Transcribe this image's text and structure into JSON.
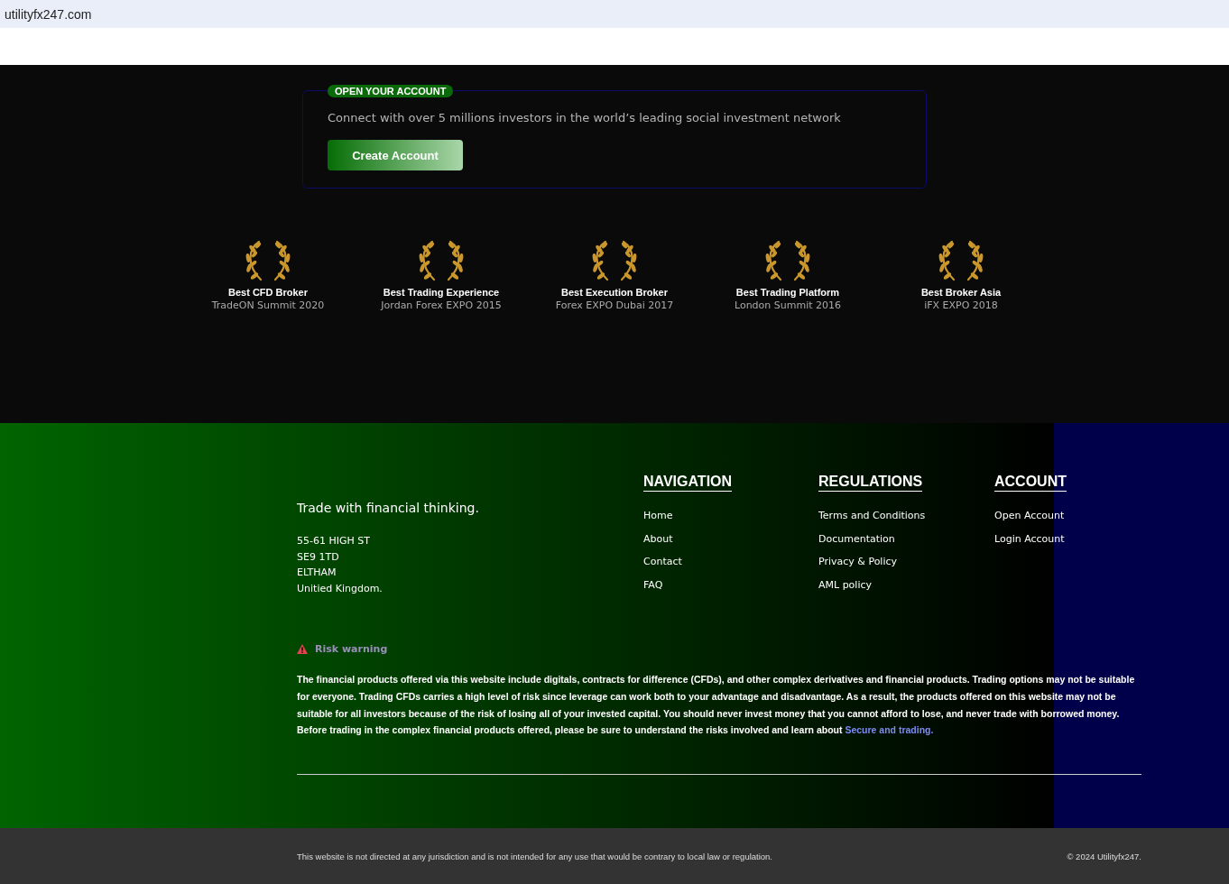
{
  "browser": {
    "url": "utilityfx247.com"
  },
  "cta": {
    "badge": "OPEN YOUR ACCOUNT",
    "text": "Connect with over 5 millions investors in the world’s leading social investment network",
    "button": "Create Account"
  },
  "awards": [
    {
      "title": "Best CFD Broker",
      "event": "TradeON Summit 2020"
    },
    {
      "title": "Best Trading Experience",
      "event": "Jordan Forex EXPO 2015"
    },
    {
      "title": "Best Execution Broker",
      "event": "Forex EXPO Dubai 2017"
    },
    {
      "title": "Best Trading Platform",
      "event": "London Summit 2016"
    },
    {
      "title": "Best Broker Asia",
      "event": "iFX EXPO 2018"
    }
  ],
  "footer": {
    "tagline": "Trade with financial thinking.",
    "address": [
      "55-61 HIGH ST",
      "SE9 1TD",
      "ELTHAM",
      "Unitied Kingdom."
    ],
    "columns": [
      {
        "heading": "NAVIGATION",
        "links": [
          "Home",
          "About",
          "Contact",
          "FAQ"
        ]
      },
      {
        "heading": "REGULATIONS",
        "links": [
          "Terms and Conditions",
          "Documentation",
          "Privacy & Policy",
          "AML policy"
        ]
      },
      {
        "heading": "ACCOUNT",
        "links": [
          "Open Account",
          "Login Account"
        ]
      }
    ],
    "risk_heading": "Risk warning",
    "risk_text": "The financial products offered via this website include digitals, contracts for difference (CFDs), and other complex derivatives and financial products. Trading options may not be suitable for everyone. Trading CFDs carries a high level of risk since leverage can work both to your advantage and disadvantage. As a result, the products offered on this website may not be suitable for all investors because of the risk of losing all of your invested capital. You should never invest money that you cannot afford to lose, and never trade with borrowed money. Before trading in the complex financial products offered, please be sure to understand the risks involved and learn about",
    "risk_link": "Secure and trading."
  },
  "bottom": {
    "disclaimer": "This website is not directed at any jurisdiction and is not intended for any use that would be contrary to local law or regulation.",
    "copyright": "© 2024 Utilityfx247."
  }
}
